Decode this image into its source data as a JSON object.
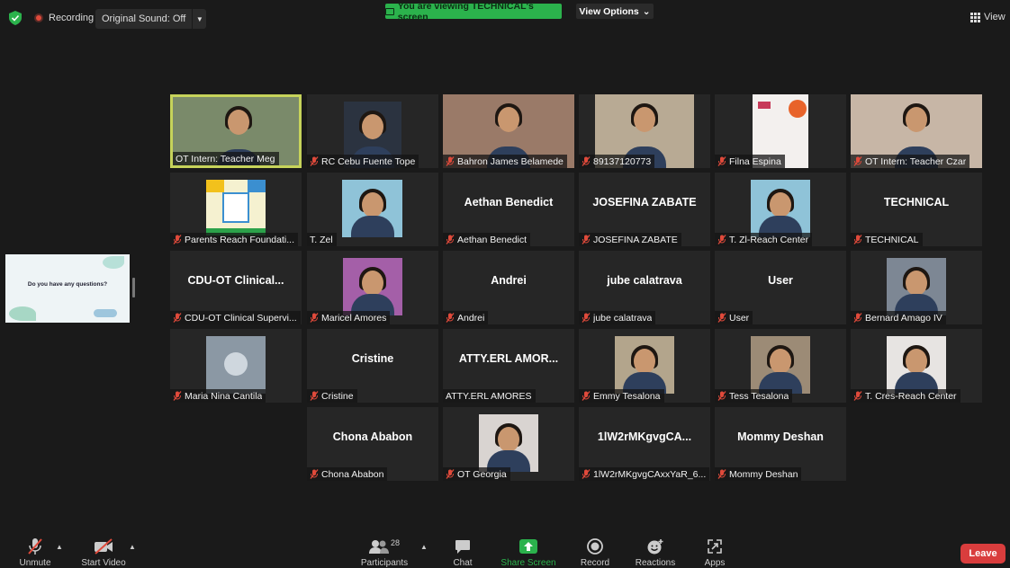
{
  "topbar": {
    "recording_label": "Recording",
    "original_sound_label": "Original Sound: Off",
    "banner_text": "You are viewing TECHNICAL's screen",
    "view_options_label": "View Options",
    "view_label": "View"
  },
  "colors": {
    "background": "#1a1a1a",
    "tile": "#262626",
    "active_speaker_border": "#c6d35a",
    "banner_green": "#2bb24c",
    "muted_red": "#e04a3b",
    "leave_red": "#d93d3d"
  },
  "shared_screen": {
    "slide_text": "Do you have any questions?"
  },
  "participants": [
    {
      "name": "OT Intern: Teacher Meg",
      "center": "",
      "muted": false,
      "video": true,
      "active": true
    },
    {
      "name": "RC Cebu Fuente Tope",
      "center": "",
      "muted": true,
      "video": true,
      "active": false
    },
    {
      "name": "Bahron James Belamede",
      "center": "",
      "muted": true,
      "video": true,
      "active": false
    },
    {
      "name": "89137120773",
      "center": "",
      "muted": true,
      "video": true,
      "active": false
    },
    {
      "name": "Filna Espina",
      "center": "",
      "muted": true,
      "video": true,
      "active": false
    },
    {
      "name": "OT Intern: Teacher Czar",
      "center": "",
      "muted": true,
      "video": true,
      "active": false
    },
    {
      "name": "Parents Reach Foundati...",
      "center": "",
      "muted": true,
      "video": true,
      "active": false
    },
    {
      "name": "T. Zel",
      "center": "",
      "muted": false,
      "video": true,
      "active": false
    },
    {
      "name": "Aethan Benedict",
      "center": "Aethan Benedict",
      "muted": true,
      "video": false,
      "active": false
    },
    {
      "name": "JOSEFINA ZABATE",
      "center": "JOSEFINA ZABATE",
      "muted": true,
      "video": false,
      "active": false
    },
    {
      "name": "T. Zl-Reach Center",
      "center": "",
      "muted": true,
      "video": true,
      "active": false
    },
    {
      "name": "TECHNICAL",
      "center": "TECHNICAL",
      "muted": true,
      "video": false,
      "active": false
    },
    {
      "name": "CDU-OT Clinical Supervi...",
      "center": "CDU-OT  Clinical...",
      "muted": true,
      "video": false,
      "active": false
    },
    {
      "name": "Maricel Amores",
      "center": "",
      "muted": true,
      "video": true,
      "active": false
    },
    {
      "name": "Andrei",
      "center": "Andrei",
      "muted": true,
      "video": false,
      "active": false
    },
    {
      "name": "jube calatrava",
      "center": "jube calatrava",
      "muted": true,
      "video": false,
      "active": false
    },
    {
      "name": "User",
      "center": "User",
      "muted": true,
      "video": false,
      "active": false
    },
    {
      "name": "Bernard Amago IV",
      "center": "",
      "muted": true,
      "video": true,
      "active": false
    },
    {
      "name": "Maria Nina Cantila",
      "center": "",
      "muted": true,
      "video": true,
      "active": false
    },
    {
      "name": "Cristine",
      "center": "Cristine",
      "muted": true,
      "video": false,
      "active": false
    },
    {
      "name": "ATTY.ERL AMORES",
      "center": "ATTY.ERL  AMOR...",
      "muted": false,
      "video": false,
      "active": false
    },
    {
      "name": "Emmy Tesalona",
      "center": "",
      "muted": true,
      "video": true,
      "active": false
    },
    {
      "name": "Tess Tesalona",
      "center": "",
      "muted": true,
      "video": true,
      "active": false
    },
    {
      "name": "T. Cres-Reach Center",
      "center": "",
      "muted": true,
      "video": true,
      "active": false
    },
    {
      "name": "Chona Ababon",
      "center": "Chona Ababon",
      "muted": true,
      "video": false,
      "active": false
    },
    {
      "name": "OT Georgia",
      "center": "",
      "muted": true,
      "video": true,
      "active": false
    },
    {
      "name": "1lW2rMKgvgCAxxYaR_6...",
      "center": "1lW2rMKgvgCA...",
      "muted": true,
      "video": false,
      "active": false
    },
    {
      "name": "Mommy Deshan",
      "center": "Mommy Deshan",
      "muted": true,
      "video": false,
      "active": false
    }
  ],
  "toolbar": {
    "unmute_label": "Unmute",
    "start_video_label": "Start Video",
    "participants_label": "Participants",
    "participants_count": "28",
    "chat_label": "Chat",
    "share_screen_label": "Share Screen",
    "record_label": "Record",
    "reactions_label": "Reactions",
    "apps_label": "Apps",
    "leave_label": "Leave"
  }
}
